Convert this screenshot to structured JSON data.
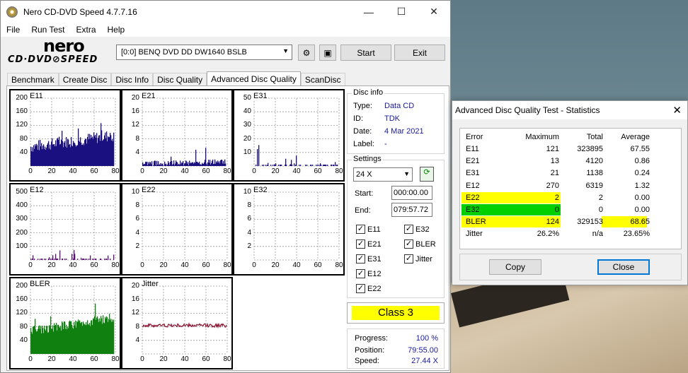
{
  "window": {
    "title": "Nero CD-DVD Speed 4.7.7.16",
    "min": "—",
    "max": "☐",
    "close": "✕"
  },
  "menu": [
    "File",
    "Run Test",
    "Extra",
    "Help"
  ],
  "logo": {
    "top": "nero",
    "bottom": "CD·DVD⊘SPEED"
  },
  "toolbar": {
    "drive": "[0:0]  BENQ DVD DD DW1640 BSLB",
    "start_label": "Start",
    "exit_label": "Exit"
  },
  "tabs": [
    "Benchmark",
    "Create Disc",
    "Disc Info",
    "Disc Quality",
    "Advanced Disc Quality",
    "ScanDisc"
  ],
  "active_tab": "Advanced Disc Quality",
  "disc_info": {
    "title": "Disc info",
    "type_label": "Type:",
    "type": "Data CD",
    "id_label": "ID:",
    "id": "TDK",
    "date_label": "Date:",
    "date": "4 Mar 2021",
    "label_label": "Label:",
    "label": "-"
  },
  "settings": {
    "title": "Settings",
    "speed": "24 X",
    "start_label": "Start:",
    "start": "000:00.00",
    "end_label": "End:",
    "end": "079:57.72",
    "checks": [
      {
        "label": "E11",
        "checked": true
      },
      {
        "label": "E32",
        "checked": true
      },
      {
        "label": "E21",
        "checked": true
      },
      {
        "label": "BLER",
        "checked": true
      },
      {
        "label": "E31",
        "checked": true
      },
      {
        "label": "Jitter",
        "checked": true
      },
      {
        "label": "E12",
        "checked": true
      },
      {
        "label": "E22",
        "checked": true
      }
    ]
  },
  "class_label": "Class 3",
  "progress": {
    "progress_label": "Progress:",
    "progress": "100 %",
    "position_label": "Position:",
    "position": "79:55.00",
    "speed_label": "Speed:",
    "speed": "27.44 X"
  },
  "graphs": [
    {
      "name": "E11",
      "yticks": [
        "200",
        "160",
        "120",
        "80",
        "40"
      ],
      "color": "#1a1080",
      "level": 0.38,
      "noise": 0.18,
      "max": 200
    },
    {
      "name": "E21",
      "yticks": [
        "20",
        "16",
        "12",
        "8",
        "4"
      ],
      "color": "#1a1080",
      "level": 0.05,
      "noise": 0.08,
      "max": 20
    },
    {
      "name": "E31",
      "yticks": [
        "50",
        "40",
        "30",
        "20",
        "10"
      ],
      "color": "#1a1080",
      "level": 0.0,
      "noise": 0.06,
      "max": 50
    },
    {
      "name": "E12",
      "yticks": [
        "500",
        "400",
        "300",
        "200",
        "100"
      ],
      "color": "#5a1070",
      "level": 0.0,
      "noise": 0.05,
      "max": 500
    },
    {
      "name": "E22",
      "yticks": [
        "10",
        "8",
        "6",
        "4",
        "2"
      ],
      "color": "#1a1080",
      "level": 0.0,
      "noise": 0.0,
      "max": 10
    },
    {
      "name": "E32",
      "yticks": [
        "10",
        "8",
        "6",
        "4",
        "2"
      ],
      "color": "#1a1080",
      "level": 0.0,
      "noise": 0.0,
      "max": 10
    },
    {
      "name": "BLER",
      "yticks": [
        "200",
        "160",
        "120",
        "80",
        "40"
      ],
      "color": "#108010",
      "level": 0.45,
      "noise": 0.14,
      "max": 200
    },
    {
      "name": "Jitter",
      "yticks": [
        "20",
        "16",
        "12",
        "8",
        "4"
      ],
      "color": "#8a1030",
      "level": 0.0,
      "noise": 0.0,
      "max": 20
    }
  ],
  "xticks": [
    "0",
    "20",
    "40",
    "60",
    "80"
  ],
  "stats": {
    "title": "Advanced Disc Quality Test - Statistics",
    "headers": [
      "Error",
      "Maximum",
      "Total",
      "Average"
    ],
    "rows": [
      {
        "error": "E11",
        "max": "121",
        "total": "323895",
        "avg": "67.55"
      },
      {
        "error": "E21",
        "max": "13",
        "total": "4120",
        "avg": "0.86"
      },
      {
        "error": "E31",
        "max": "21",
        "total": "1138",
        "avg": "0.24"
      },
      {
        "error": "E12",
        "max": "270",
        "total": "6319",
        "avg": "1.32"
      },
      {
        "error": "E22",
        "max": "2",
        "total": "2",
        "avg": "0.00"
      },
      {
        "error": "E32",
        "max": "0",
        "total": "0",
        "avg": "0.00"
      },
      {
        "error": "BLER",
        "max": "124",
        "total": "329153",
        "avg": "68.65"
      },
      {
        "error": "Jitter",
        "max": "26.2%",
        "total": "n/a",
        "avg": "23.65%"
      }
    ],
    "copy_label": "Copy",
    "close_label": "Close",
    "yellow": "#ffff00",
    "green": "#00d000"
  }
}
